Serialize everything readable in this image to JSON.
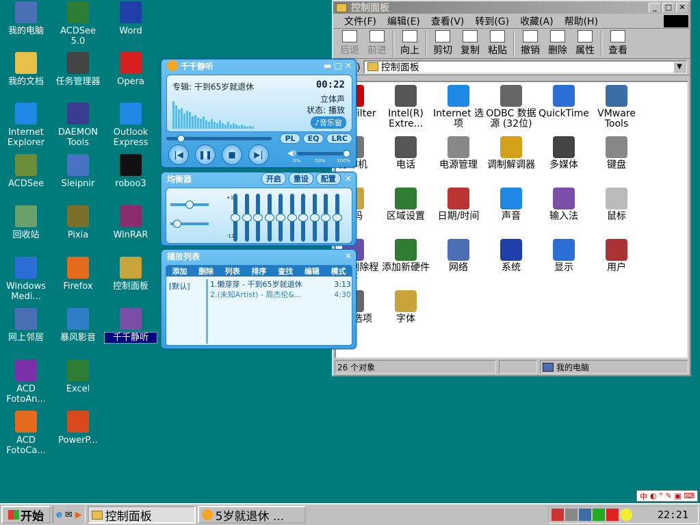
{
  "desktop": {
    "icons": [
      {
        "label": "我的电脑",
        "icon": "my-computer-icon",
        "color": "#4a6fb5"
      },
      {
        "label": "ACDSee 5.0",
        "icon": "acdsee-eye-icon",
        "color": "#2e7d32"
      },
      {
        "label": "Word",
        "icon": "word-icon",
        "color": "#1f3fa8"
      },
      {
        "label": "我的文档",
        "icon": "folder-docs-icon",
        "color": "#e6c04a"
      },
      {
        "label": "任务管理器",
        "icon": "task-manager-icon",
        "color": "#444"
      },
      {
        "label": "Opera",
        "icon": "opera-icon",
        "color": "#d81f1f"
      },
      {
        "label": "Internet Explorer",
        "icon": "ie-icon",
        "color": "#1e88e5"
      },
      {
        "label": "DAEMON Tools",
        "icon": "daemon-tools-icon",
        "color": "#3b3b8f"
      },
      {
        "label": "Outlook Express",
        "icon": "outlook-express-icon",
        "color": "#1e88e5"
      },
      {
        "label": "ACDSee",
        "icon": "acdsee-icon",
        "color": "#6c8e3a"
      },
      {
        "label": "Sleipnir",
        "icon": "sleipnir-icon",
        "color": "#4a72c4"
      },
      {
        "label": "roboo3",
        "icon": "roboo-icon",
        "color": "#111"
      },
      {
        "label": "回收站",
        "icon": "recycle-bin-icon",
        "color": "#6aa06a"
      },
      {
        "label": "Pixia",
        "icon": "pixia-icon",
        "color": "#7b6f2a"
      },
      {
        "label": "WinRAR",
        "icon": "winrar-icon",
        "color": "#8b2c6f"
      },
      {
        "label": "Windows Medi...",
        "icon": "media-player-icon",
        "color": "#2b6fd6"
      },
      {
        "label": "Firefox",
        "icon": "firefox-icon",
        "color": "#e56a1c"
      },
      {
        "label": "控制面板",
        "icon": "control-panel-icon",
        "color": "#c9a43b"
      },
      {
        "label": "网上邻居",
        "icon": "network-neighborhood-icon",
        "color": "#4a6fb5"
      },
      {
        "label": "暴风影音",
        "icon": "storm-player-icon",
        "color": "#2f7cc7"
      },
      {
        "label": "千千静听",
        "icon": "ttplayer-icon",
        "color": "#7b4fa8"
      },
      {
        "label": "ACD FotoAn...",
        "icon": "fotoangelo-icon",
        "color": "#7b2fa8"
      },
      {
        "label": "Excel",
        "icon": "excel-icon",
        "color": "#2e7d32"
      },
      {
        "label": "ACD FotoCa...",
        "icon": "fotocanvas-icon",
        "color": "#e56a1c"
      },
      {
        "label": "PowerP...",
        "icon": "powerpoint-icon",
        "color": "#d84a1c"
      }
    ]
  },
  "explorer": {
    "title": "控制面板",
    "menu": [
      "文件(F)",
      "编辑(E)",
      "查看(V)",
      "转到(G)",
      "收藏(A)",
      "帮助(H)"
    ],
    "toolbar": [
      {
        "label": "后退",
        "icon": "back-arrow-icon",
        "enabled": false
      },
      {
        "label": "前进",
        "icon": "forward-arrow-icon",
        "enabled": false
      },
      {
        "label": "向上",
        "icon": "up-folder-icon",
        "enabled": true
      },
      {
        "label": "剪切",
        "icon": "scissors-icon",
        "enabled": true
      },
      {
        "label": "复制",
        "icon": "copy-icon",
        "enabled": true
      },
      {
        "label": "粘贴",
        "icon": "paste-icon",
        "enabled": true
      },
      {
        "label": "撤销",
        "icon": "undo-icon",
        "enabled": true
      },
      {
        "label": "删除",
        "icon": "delete-x-icon",
        "enabled": true
      },
      {
        "label": "属性",
        "icon": "properties-icon",
        "enabled": true
      },
      {
        "label": "查看",
        "icon": "view-icon",
        "enabled": true
      }
    ],
    "address_label": "址(D)",
    "address_value": "控制面板",
    "items": [
      {
        "label": "AC3 Filter",
        "icon": "ac3filter-icon",
        "color": "#c00"
      },
      {
        "label": "Intel(R) Extre...",
        "icon": "intel-icon",
        "color": "#555"
      },
      {
        "label": "Internet 选项",
        "icon": "internet-options-icon",
        "color": "#1e88e5"
      },
      {
        "label": "ODBC 数据源 (32位)",
        "icon": "odbc-icon",
        "color": "#666"
      },
      {
        "label": "QuickTime",
        "icon": "quicktime-icon",
        "color": "#2b6fd6"
      },
      {
        "label": "VMware Tools",
        "icon": "vmware-icon",
        "color": "#3a6ea5"
      },
      {
        "label": "打印机",
        "icon": "printer-icon",
        "color": "#777"
      },
      {
        "label": "电话",
        "icon": "phone-icon",
        "color": "#555"
      },
      {
        "label": "电源管理",
        "icon": "power-icon",
        "color": "#888"
      },
      {
        "label": "调制解调器",
        "icon": "modem-icon",
        "color": "#d4a017"
      },
      {
        "label": "多媒体",
        "icon": "multimedia-icon",
        "color": "#444"
      },
      {
        "label": "键盘",
        "icon": "keyboard-icon",
        "color": "#888"
      },
      {
        "label": "密码",
        "icon": "keys-icon",
        "color": "#c9a43b"
      },
      {
        "label": "区域设置",
        "icon": "globe-icon",
        "color": "#2e7d32"
      },
      {
        "label": "日期/时间",
        "icon": "calendar-clock-icon",
        "color": "#b33"
      },
      {
        "label": "声音",
        "icon": "sound-icon",
        "color": "#1e88e5"
      },
      {
        "label": "输入法",
        "icon": "ime-icon",
        "color": "#7b4fa8"
      },
      {
        "label": "鼠标",
        "icon": "mouse-icon",
        "color": "#bbb"
      },
      {
        "label": "添加/删除程序",
        "icon": "add-remove-programs-icon",
        "color": "#6a4fa8"
      },
      {
        "label": "添加新硬件",
        "icon": "add-hardware-icon",
        "color": "#2e7d32"
      },
      {
        "label": "网络",
        "icon": "network-icon",
        "color": "#4a6fb5"
      },
      {
        "label": "系统",
        "icon": "system-icon",
        "color": "#1f3fa8"
      },
      {
        "label": "显示",
        "icon": "display-icon",
        "color": "#2b6fd6"
      },
      {
        "label": "用户",
        "icon": "users-icon",
        "color": "#a33"
      },
      {
        "label": "游戏选项",
        "icon": "joystick-icon",
        "color": "#666"
      },
      {
        "label": "字体",
        "icon": "fonts-icon",
        "color": "#c9a43b"
      }
    ],
    "status_count": "26 个对象",
    "status_location": "我的电脑"
  },
  "player": {
    "title": "千千静听",
    "album": "专辑: 干到65岁就退休",
    "time": "00:22",
    "channels": "立体声",
    "state": "状态: 播放",
    "mini_mode": "♪音乐窗",
    "tabs": [
      "PL",
      "EQ",
      "LRC"
    ],
    "volume_ticks": [
      "0%",
      "50%",
      "100%"
    ],
    "volume": 0.95,
    "progress": 0.12,
    "eq_title": "均衡器",
    "eq_buttons": [
      "开启",
      "重设",
      "配置"
    ],
    "eq_scale_top": "+12",
    "eq_scale_mid": "0",
    "eq_scale_bottom": "-12",
    "eq_bands": [
      0,
      0,
      0,
      0,
      0,
      0,
      0,
      0,
      0,
      0
    ],
    "playlist_title": "播放列表",
    "playlist_menu": [
      "添加",
      "删除",
      "列表",
      "排序",
      "查找",
      "编辑",
      "模式"
    ],
    "playlist_group": "[默认]",
    "tracks": [
      {
        "title": "1.懒芽芽 - 干到65岁就退休",
        "duration": "3:13"
      },
      {
        "title": "2.(未知Artist) - 周杰伦&...",
        "duration": "4:30"
      }
    ]
  },
  "taskbar": {
    "start_label": "开始",
    "tasks": [
      {
        "label": "控制面板",
        "icon": "control-panel-folder-icon",
        "active": true
      },
      {
        "label": "5岁就退休 ...",
        "icon": "ttplayer-icon",
        "active": false
      }
    ],
    "clock": "22:21"
  },
  "ime_bar": {
    "label": "中"
  }
}
